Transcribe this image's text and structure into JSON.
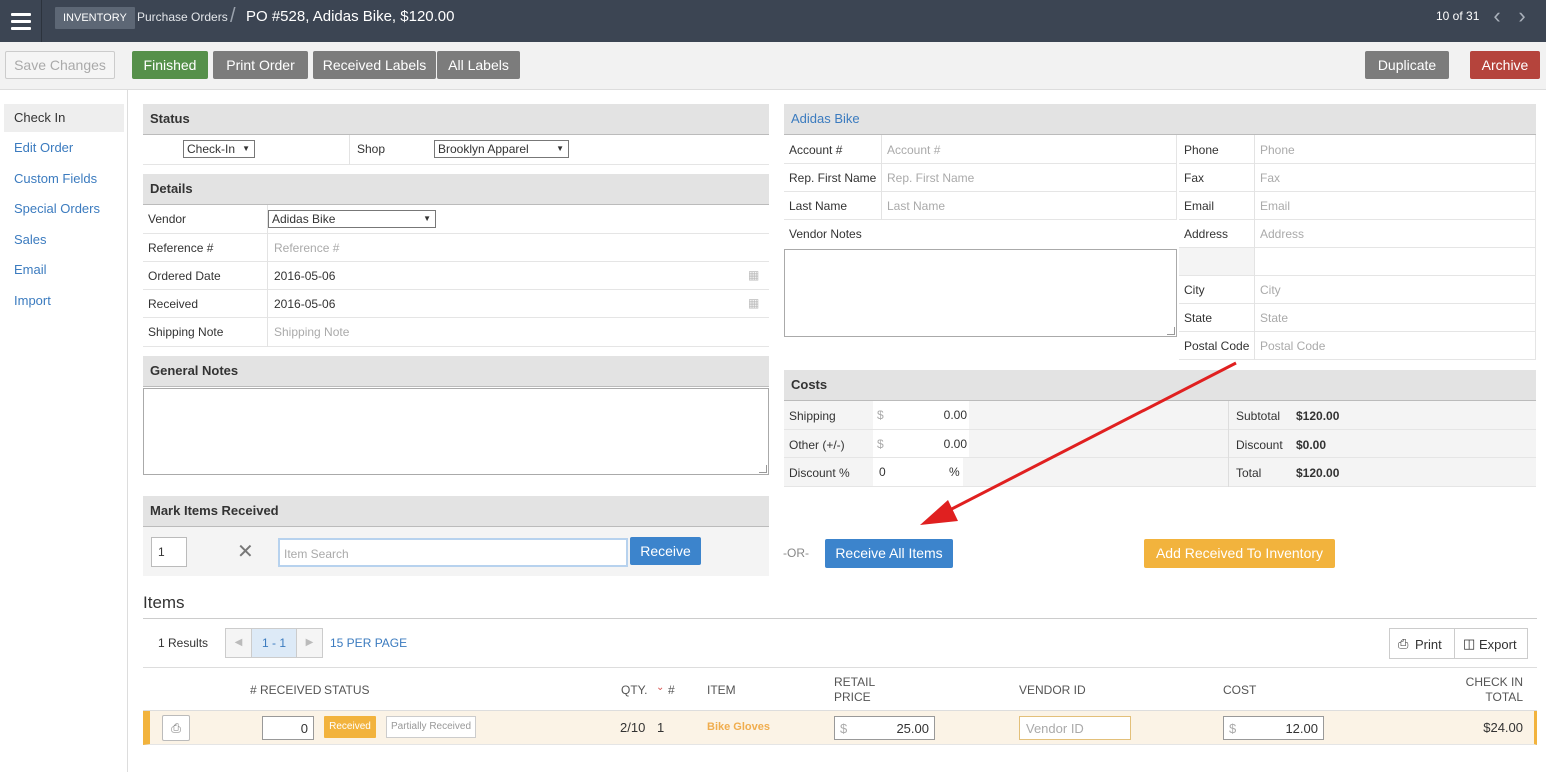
{
  "header": {
    "breadcrumb_inventory": "INVENTORY",
    "breadcrumb_purchase_orders": "Purchase Orders",
    "title": "PO #528, Adidas Bike, $120.00",
    "pager": "10 of 31"
  },
  "toolbar": {
    "save": "Save Changes",
    "finished": "Finished",
    "print_order": "Print Order",
    "received_labels": "Received Labels",
    "all_labels": "All Labels",
    "duplicate": "Duplicate",
    "archive": "Archive"
  },
  "sidebar": {
    "items": [
      {
        "label": "Check In"
      },
      {
        "label": "Edit Order"
      },
      {
        "label": "Custom Fields"
      },
      {
        "label": "Special Orders"
      },
      {
        "label": "Sales"
      },
      {
        "label": "Email"
      },
      {
        "label": "Import"
      }
    ]
  },
  "status": {
    "heading": "Status",
    "value": "Check-In",
    "shop_label": "Shop",
    "shop_value": "Brooklyn Apparel"
  },
  "details": {
    "heading": "Details",
    "vendor_label": "Vendor",
    "vendor_value": "Adidas Bike",
    "reference_label": "Reference #",
    "reference_placeholder": "Reference #",
    "ordered_label": "Ordered Date",
    "ordered_value": "2016-05-06",
    "received_label": "Received",
    "received_value": "2016-05-06",
    "shipping_label": "Shipping Note",
    "shipping_placeholder": "Shipping Note"
  },
  "general_notes": {
    "heading": "General Notes"
  },
  "mark_received": {
    "heading": "Mark Items Received",
    "qty": "1",
    "search_placeholder": "Item Search",
    "receive": "Receive",
    "or": "-OR-",
    "receive_all": "Receive All Items",
    "add_to_inventory": "Add Received To Inventory"
  },
  "vendor": {
    "name": "Adidas Bike",
    "account_label": "Account #",
    "account_placeholder": "Account #",
    "rep_label": "Rep. First Name",
    "rep_placeholder": "Rep. First Name",
    "last_label": "Last Name",
    "last_placeholder": "Last Name",
    "notes_label": "Vendor Notes",
    "phone_label": "Phone",
    "phone_placeholder": "Phone",
    "fax_label": "Fax",
    "fax_placeholder": "Fax",
    "email_label": "Email",
    "email_placeholder": "Email",
    "address_label": "Address",
    "address_placeholder": "Address",
    "city_label": "City",
    "city_placeholder": "City",
    "state_label": "State",
    "state_placeholder": "State",
    "postal_label": "Postal Code",
    "postal_placeholder": "Postal Code"
  },
  "costs": {
    "heading": "Costs",
    "shipping_label": "Shipping",
    "shipping_currency": "$",
    "shipping_value": "0.00",
    "other_label": "Other (+/-)",
    "other_currency": "$",
    "other_value": "0.00",
    "discount_pct_label": "Discount %",
    "discount_pct_value": "0",
    "discount_pct_unit": "%",
    "subtotal_label": "Subtotal",
    "subtotal_value": "$120.00",
    "discount_label": "Discount",
    "discount_value": "$0.00",
    "total_label": "Total",
    "total_value": "$120.00"
  },
  "items": {
    "heading": "Items",
    "results": "1 Results",
    "page_range": "1 - 1",
    "per_page": "15 PER PAGE",
    "print": "Print",
    "export": "Export",
    "columns": {
      "received": "# RECEIVED",
      "status": "STATUS",
      "qty": "QTY.",
      "num": "#",
      "item": "ITEM",
      "retail_line1": "RETAIL",
      "retail_line2": "PRICE",
      "vendor_id": "VENDOR ID",
      "cost": "COST",
      "checkin_line1": "CHECK IN",
      "checkin_line2": "TOTAL"
    },
    "rows": [
      {
        "received": "0",
        "status_received": "Received",
        "status_partial": "Partially Received",
        "qty": "2/10",
        "num": "1",
        "item": "Bike Gloves",
        "retail_currency": "$",
        "retail": "25.00",
        "vendor_id_placeholder": "Vendor ID",
        "cost_currency": "$",
        "cost": "12.00",
        "total": "$24.00"
      }
    ]
  },
  "colors": {
    "topbar": "#3c4553",
    "finished": "#55904a",
    "gray_button": "#7c7c7c",
    "archive": "#b5443c",
    "primary": "#3c84cc",
    "warning": "#f2b33d",
    "annotation_arrow": "#e02020"
  }
}
